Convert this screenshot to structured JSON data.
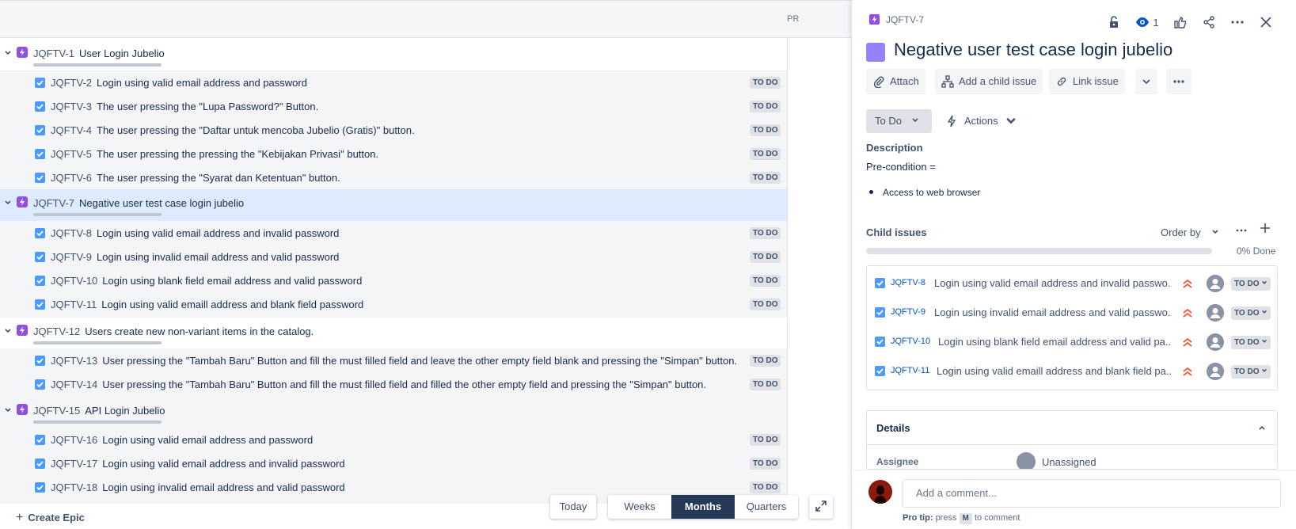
{
  "timeline": {
    "column_header": "PR",
    "epics": [
      {
        "key": "JQFTV-1",
        "summary": "User Login Jubelio",
        "children": [
          {
            "key": "JQFTV-2",
            "summary": "Login using valid email address and password",
            "status": "TO DO"
          },
          {
            "key": "JQFTV-3",
            "summary": "The user pressing the \"Lupa Password?\" Button.",
            "status": "TO DO"
          },
          {
            "key": "JQFTV-4",
            "summary": "The user pressing the \"Daftar untuk mencoba Jubelio (Gratis)\" button.",
            "status": "TO DO"
          },
          {
            "key": "JQFTV-5",
            "summary": "The user pressing the pressing the \"Kebijakan Privasi\" button.",
            "status": "TO DO"
          },
          {
            "key": "JQFTV-6",
            "summary": "The user pressing the \"Syarat dan Ketentuan\" button.",
            "status": "TO DO"
          }
        ]
      },
      {
        "key": "JQFTV-7",
        "summary": "Negative user test case login jubelio",
        "children": [
          {
            "key": "JQFTV-8",
            "summary": "Login using valid email address and invalid password",
            "status": "TO DO"
          },
          {
            "key": "JQFTV-9",
            "summary": "Login using invalid email address and valid password",
            "status": "TO DO"
          },
          {
            "key": "JQFTV-10",
            "summary": "Login using blank field email address and valid password",
            "status": "TO DO"
          },
          {
            "key": "JQFTV-11",
            "summary": "Login using valid emaill address and blank field password",
            "status": "TO DO"
          }
        ]
      },
      {
        "key": "JQFTV-12",
        "summary": "Users create new non-variant items in the catalog.",
        "children": [
          {
            "key": "JQFTV-13",
            "summary": "User pressing the \"Tambah Baru\" Button and fill the must filled field and leave the other empty field blank and pressing the \"Simpan\" button.",
            "status": "TO DO"
          },
          {
            "key": "JQFTV-14",
            "summary": "User pressing the \"Tambah Baru\" Button and fill the must filled field and filled the other empty field and pressing the \"Simpan\" button.",
            "status": "TO DO"
          }
        ]
      },
      {
        "key": "JQFTV-15",
        "summary": "API Login Jubelio",
        "children": [
          {
            "key": "JQFTV-16",
            "summary": "Login using valid email address and password",
            "status": "TO DO"
          },
          {
            "key": "JQFTV-17",
            "summary": "Login using valid email address and invalid password",
            "status": "TO DO"
          },
          {
            "key": "JQFTV-18",
            "summary": "Login using invalid email address and valid password",
            "status": "TO DO"
          }
        ]
      }
    ],
    "create_epic": "Create Epic",
    "today": "Today",
    "range_options": [
      "Weeks",
      "Months",
      "Quarters"
    ],
    "range_selected": "Months"
  },
  "panel": {
    "issue_key": "JQFTV-7",
    "watch_count": "1",
    "title": "Negative user test case login jubelio",
    "buttons": {
      "attach": "Attach",
      "add_child": "Add a child issue",
      "link_issue": "Link issue"
    },
    "status": "To Do",
    "actions": "Actions",
    "description_label": "Description",
    "description_pre": "Pre-condition =",
    "description_bullet": "Access to web browser",
    "child_issues_label": "Child issues",
    "order_by": "Order by",
    "progress_percent": 0,
    "progress_text": "0% Done",
    "children": [
      {
        "key": "JQFTV-8",
        "summary": "Login using valid email address and invalid passwo...",
        "status": "TO DO"
      },
      {
        "key": "JQFTV-9",
        "summary": "Login using invalid email address and valid passwo...",
        "status": "TO DO"
      },
      {
        "key": "JQFTV-10",
        "summary": "Login using blank field email address and valid pa...",
        "status": "TO DO"
      },
      {
        "key": "JQFTV-11",
        "summary": "Login using valid emaill address and blank field pa...",
        "status": "TO DO"
      }
    ],
    "details_label": "Details",
    "assignee_label": "Assignee",
    "assignee_value": "Unassigned",
    "comment_placeholder": "Add a comment...",
    "protip_label": "Pro tip:",
    "protip_press": "press",
    "protip_key": "M",
    "protip_rest": "to comment",
    "colors": {
      "epic": "#904ee2",
      "checkbox": "#4c9aff",
      "accent_dark": "#253858",
      "priority": "#ff5630"
    }
  }
}
